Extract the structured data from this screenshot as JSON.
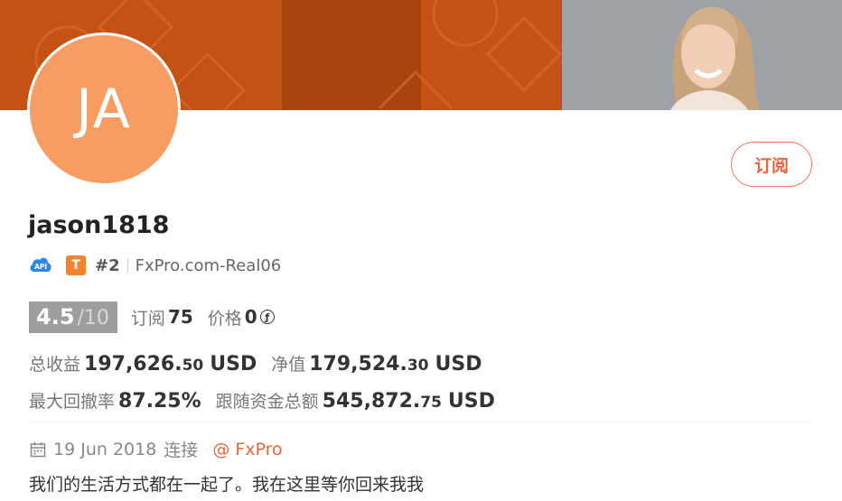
{
  "profile": {
    "avatar_initials": "JA",
    "username": "jason1818",
    "subscribe_label": "订阅",
    "api_badge": "API",
    "tier_badge": "T",
    "rank": "#2",
    "server": "FxPro.com-Real06",
    "rating_value": "4.5",
    "rating_max": "/10",
    "subscribers_label": "订阅",
    "subscribers_value": "75",
    "price_label": "价格",
    "price_value": "0",
    "price_icon": "ƒ"
  },
  "stats": {
    "total_profit_label": "总收益",
    "total_profit_main": "197,626.",
    "total_profit_cents": "50",
    "total_profit_unit": "USD",
    "equity_label": "净值",
    "equity_main": "179,524.",
    "equity_cents": "30",
    "equity_unit": "USD",
    "max_drawdown_label": "最大回撤率",
    "max_drawdown_value": "87.25%",
    "follow_funds_label": "跟随资金总额",
    "follow_funds_main": "545,872.",
    "follow_funds_cents": "75",
    "follow_funds_unit": "USD"
  },
  "meta": {
    "date": "19 Jun 2018",
    "connect_label": "连接",
    "broker": "@ FxPro",
    "icon": "calendar-icon"
  },
  "bio": "我们的生活方式都在一起了。我在这里等你回来我我",
  "colors": {
    "accent": "#e8663b",
    "avatar_bg": "#f79c62",
    "banner_orange": "#c45214",
    "rating_bg": "#9e9e9e"
  }
}
